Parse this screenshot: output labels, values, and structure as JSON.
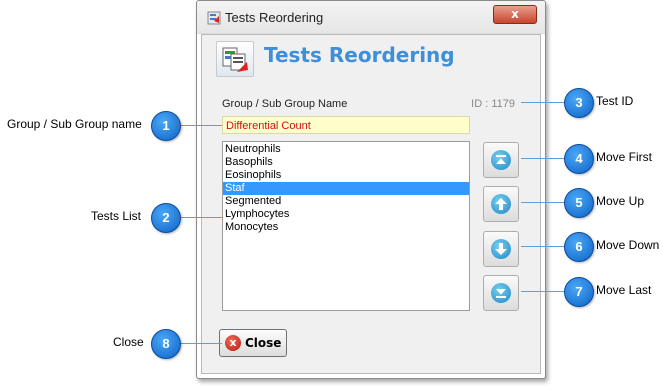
{
  "window": {
    "title": "Tests Reordering",
    "close_glyph": "x"
  },
  "header": {
    "title": "Tests Reordering"
  },
  "form": {
    "group_label": "Group / Sub Group Name",
    "id_text": "ID : 1179",
    "group_value": "Differential Count"
  },
  "tests": [
    {
      "label": "Neutrophils",
      "selected": false
    },
    {
      "label": "Basophils",
      "selected": false
    },
    {
      "label": "Eosinophils",
      "selected": false
    },
    {
      "label": "Staf",
      "selected": true
    },
    {
      "label": "Segmented",
      "selected": false
    },
    {
      "label": "Lymphocytes",
      "selected": false
    },
    {
      "label": "Monocytes",
      "selected": false
    }
  ],
  "buttons": {
    "close_label": "Close",
    "close_icon_glyph": "x"
  },
  "callouts": [
    {
      "number": "1",
      "label": "Group / Sub Group name"
    },
    {
      "number": "2",
      "label": "Tests List"
    },
    {
      "number": "3",
      "label": "Test ID"
    },
    {
      "number": "4",
      "label": "Move First"
    },
    {
      "number": "5",
      "label": "Move Up"
    },
    {
      "number": "6",
      "label": "Move Down"
    },
    {
      "number": "7",
      "label": "Move Last"
    },
    {
      "number": "8",
      "label": "Close"
    }
  ],
  "colors": {
    "accent_title": "#3e8ed8",
    "selection": "#3399ff",
    "input_bg": "#ffffcc",
    "input_text": "#d01010",
    "badge": "#0d62c7"
  },
  "icons": {
    "move_first": "move-first-icon",
    "move_up": "arrow-up-icon",
    "move_down": "arrow-down-icon",
    "move_last": "move-last-icon"
  }
}
